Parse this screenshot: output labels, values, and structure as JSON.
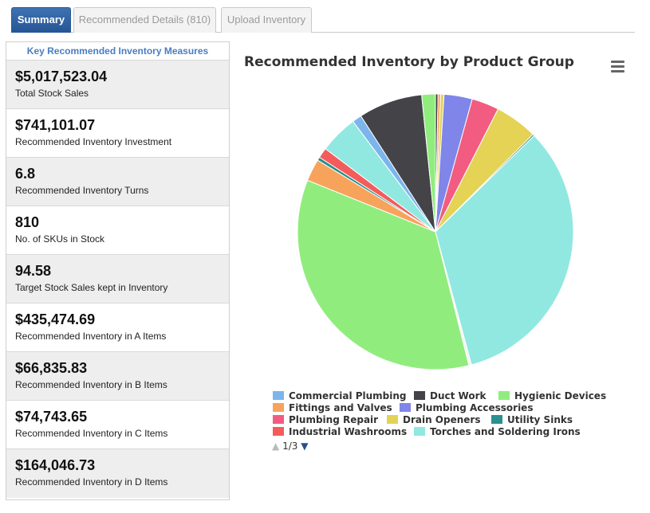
{
  "tabs": [
    {
      "label": "Summary"
    },
    {
      "label": "Recommended Details (810)"
    },
    {
      "label": "Upload Inventory"
    }
  ],
  "kpi": {
    "header": "Key Recommended Inventory Measures",
    "items": [
      {
        "value": "$5,017,523.04",
        "label": "Total Stock Sales"
      },
      {
        "value": "$741,101.07",
        "label": "Recommended Inventory Investment"
      },
      {
        "value": "6.8",
        "label": "Recommended Inventory Turns"
      },
      {
        "value": "810",
        "label": "No. of SKUs in Stock"
      },
      {
        "value": "94.58",
        "label": "Target Stock Sales kept in Inventory"
      },
      {
        "value": "$435,474.69",
        "label": "Recommended Inventory in A Items"
      },
      {
        "value": "$66,835.83",
        "label": "Recommended Inventory in B Items"
      },
      {
        "value": "$74,743.65",
        "label": "Recommended Inventory in C Items"
      },
      {
        "value": "$164,046.73",
        "label": "Recommended Inventory in D Items"
      }
    ]
  },
  "chart": {
    "title": "Recommended Inventory by Product Group",
    "menu_icon": "hamburger-menu-icon",
    "pager": {
      "text": "1/3",
      "up_icon": "triangle-up-icon",
      "down_icon": "triangle-down-icon"
    }
  },
  "chart_data": {
    "type": "pie",
    "title": "Recommended Inventory by Product Group",
    "slices": [
      {
        "name": "",
        "value": 0.3,
        "color": "#434348"
      },
      {
        "name": "",
        "value": 0.3,
        "color": "#f7a35c"
      },
      {
        "name": "",
        "value": 0.4,
        "color": "#e4d354"
      },
      {
        "name": "Plumbing Accessories",
        "value": 3.3,
        "color": "#8085e9"
      },
      {
        "name": "Plumbing Repair",
        "value": 3.2,
        "color": "#f15c80"
      },
      {
        "name": "Drain Openers",
        "value": 5.0,
        "color": "#e4d354"
      },
      {
        "name": "Utility Sinks",
        "value": 0.2,
        "color": "#2b908f"
      },
      {
        "name": "Torches and Soldering Irons",
        "value": 33.1,
        "color": "#91e8e1"
      },
      {
        "name": "",
        "value": 0.3,
        "color": "#f4f4f4"
      },
      {
        "name": "Hygienic Devices",
        "value": 35.0,
        "color": "#90ed7d"
      },
      {
        "name": "Fittings and Valves",
        "value": 2.6,
        "color": "#f7a35c"
      },
      {
        "name": "",
        "value": 0.4,
        "color": "#2b908f"
      },
      {
        "name": "Industrial Washrooms",
        "value": 1.2,
        "color": "#f45b5b"
      },
      {
        "name": "",
        "value": 4.5,
        "color": "#91e8e1"
      },
      {
        "name": "Commercial Plumbing",
        "value": 1.1,
        "color": "#7cb5ec"
      },
      {
        "name": "Duct Work",
        "value": 7.5,
        "color": "#434348"
      },
      {
        "name": "",
        "value": 1.6,
        "color": "#90ed7d"
      }
    ],
    "legend": [
      {
        "name": "Commercial Plumbing",
        "color": "#7cb5ec"
      },
      {
        "name": "Duct Work",
        "color": "#434348"
      },
      {
        "name": "Hygienic Devices",
        "color": "#90ed7d"
      },
      {
        "name": "Fittings and Valves",
        "color": "#f7a35c"
      },
      {
        "name": "Plumbing Accessories",
        "color": "#8085e9"
      },
      {
        "name": "Plumbing Repair",
        "color": "#f15c80"
      },
      {
        "name": "Drain Openers",
        "color": "#e4d354"
      },
      {
        "name": "Utility Sinks",
        "color": "#2b908f"
      },
      {
        "name": "Industrial Washrooms",
        "color": "#f45b5b"
      },
      {
        "name": "Torches and Soldering Irons",
        "color": "#91e8e1"
      }
    ],
    "legend_placement": "bottom"
  }
}
